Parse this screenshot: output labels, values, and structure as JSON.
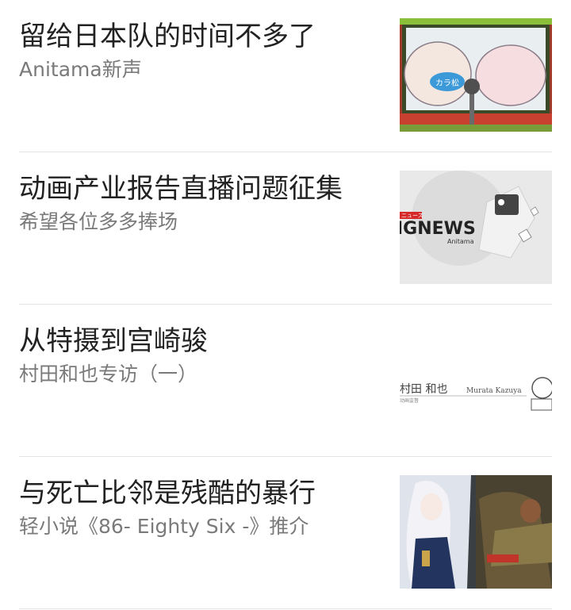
{
  "feed": {
    "items": [
      {
        "title": "留给日本队的时间不多了",
        "subtitle": "Anitama新声",
        "thumb_text": "カラ松"
      },
      {
        "title": "动画产业报告直播问题征集",
        "subtitle": "希望各位多多捧场",
        "thumb_text": "IGNEWS",
        "thumb_badge": "ニュース",
        "thumb_brand": "Anitama"
      },
      {
        "title": "从特摄到宫崎骏",
        "subtitle": "村田和也专访（一）",
        "thumb_text": "村田 和也",
        "thumb_caption": "动画监督",
        "thumb_name_en": "Murata Kazuya"
      },
      {
        "title": "与死亡比邻是残酷的暴行",
        "subtitle": "轻小说《86- Eighty Six -》推介"
      }
    ]
  }
}
